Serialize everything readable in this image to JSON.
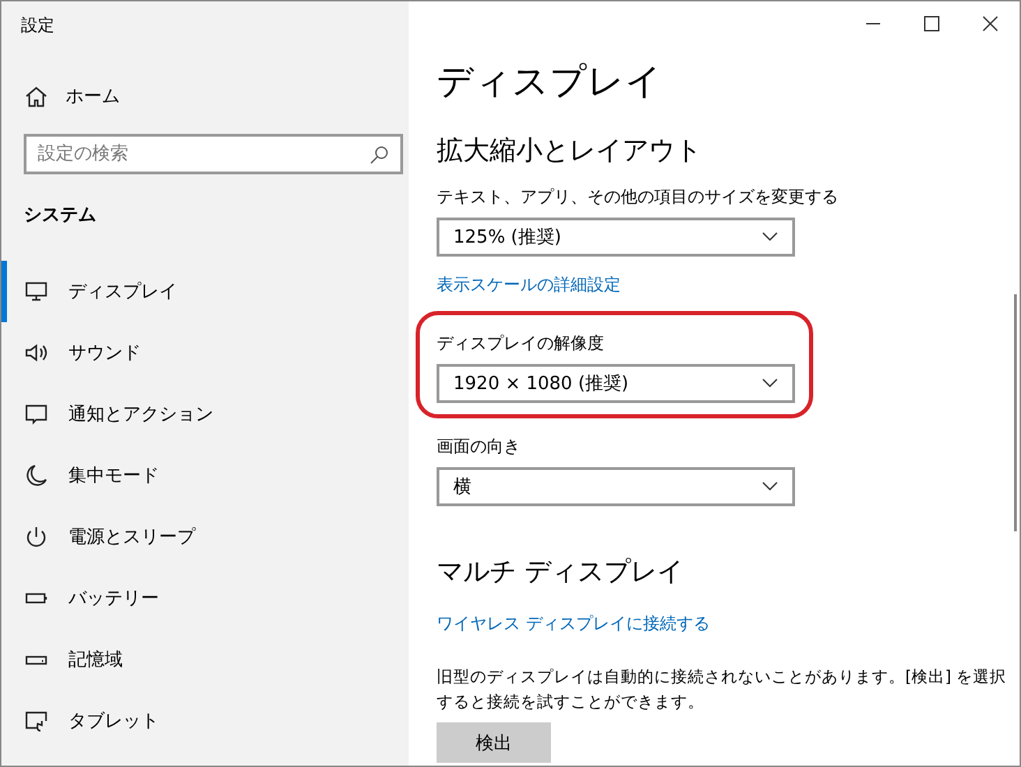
{
  "window": {
    "title": "設定"
  },
  "sidebar": {
    "home": "ホーム",
    "search": {
      "placeholder": "設定の検索"
    },
    "section": "システム",
    "items": [
      {
        "label": "ディスプレイ",
        "kind": "display",
        "selected": true
      },
      {
        "label": "サウンド",
        "kind": "sound",
        "selected": false
      },
      {
        "label": "通知とアクション",
        "kind": "notification",
        "selected": false
      },
      {
        "label": "集中モード",
        "kind": "moon",
        "selected": false
      },
      {
        "label": "電源とスリープ",
        "kind": "power",
        "selected": false
      },
      {
        "label": "バッテリー",
        "kind": "battery",
        "selected": false
      },
      {
        "label": "記憶域",
        "kind": "storage",
        "selected": false
      },
      {
        "label": "タブレット",
        "kind": "tablet",
        "selected": false
      }
    ]
  },
  "content": {
    "title": "ディスプレイ",
    "section": "拡大縮小とレイアウト",
    "settings": [
      {
        "label": "テキスト、アプリ、その他の項目のサイズを変更する",
        "value": "125% (推奨)",
        "highlighted": false,
        "link": "表示スケールの詳細設定"
      },
      {
        "label": "ディスプレイの解像度",
        "value": "1920 × 1080 (推奨)",
        "highlighted": true
      },
      {
        "label": "画面の向き",
        "value": "横",
        "highlighted": false
      }
    ],
    "multi": {
      "heading": "マルチ ディスプレイ",
      "link": "ワイヤレス ディスプレイに接続する",
      "text": "旧型のディスプレイは自動的に接続されないことがあります。[検出] を選択すると接続を試すことができます。",
      "button": "検出"
    }
  }
}
